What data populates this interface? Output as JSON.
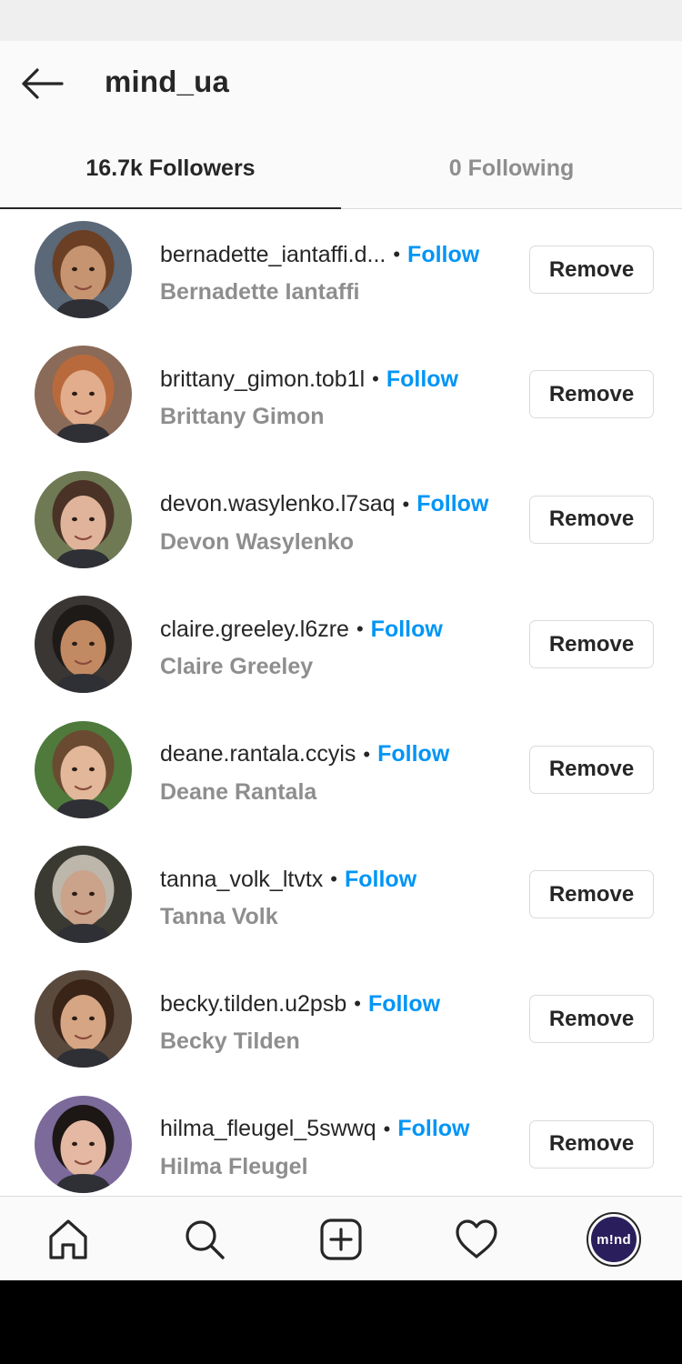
{
  "header": {
    "title": "mind_ua"
  },
  "tabs": {
    "followers": "16.7k Followers",
    "following": "0 Following"
  },
  "colors": {
    "link": "#0095f6",
    "secondary_text": "#8e8e8e",
    "primary_text": "#262626"
  },
  "followers": [
    {
      "username": "bernadette_iantaffi.d...",
      "full_name": "Bernadette Iantaffi",
      "follow_label": "Follow",
      "remove_label": "Remove",
      "skin": "#c69470",
      "hair": "#6b3f24",
      "bg": "#5a6878"
    },
    {
      "username": "brittany_gimon.tob1l",
      "full_name": "Brittany Gimon",
      "follow_label": "Follow",
      "remove_label": "Remove",
      "skin": "#e2ad8c",
      "hair": "#b86a3c",
      "bg": "#8a6a58"
    },
    {
      "username": "devon.wasylenko.l7saq",
      "full_name": "Devon Wasylenko",
      "follow_label": "Follow",
      "remove_label": "Remove",
      "skin": "#e0b49a",
      "hair": "#4a3326",
      "bg": "#6f7a55"
    },
    {
      "username": "claire.greeley.l6zre",
      "full_name": "Claire Greeley",
      "follow_label": "Follow",
      "remove_label": "Remove",
      "skin": "#c28a63",
      "hair": "#1e1a17",
      "bg": "#3a3634"
    },
    {
      "username": "deane.rantala.ccyis",
      "full_name": "Deane Rantala",
      "follow_label": "Follow",
      "remove_label": "Remove",
      "skin": "#e2b79a",
      "hair": "#6a4a30",
      "bg": "#4f7a3c"
    },
    {
      "username": "tanna_volk_ltvtx",
      "full_name": "Tanna Volk",
      "follow_label": "Follow",
      "remove_label": "Remove",
      "skin": "#caa38a",
      "hair": "#bcb6ab",
      "bg": "#3b3a32"
    },
    {
      "username": "becky.tilden.u2psb",
      "full_name": "Becky Tilden",
      "follow_label": "Follow",
      "remove_label": "Remove",
      "skin": "#d6a584",
      "hair": "#3a2418",
      "bg": "#5a4a3e"
    },
    {
      "username": "hilma_fleugel_5swwq",
      "full_name": "Hilma Fleugel",
      "follow_label": "Follow",
      "remove_label": "Remove",
      "skin": "#e4b8a2",
      "hair": "#1c1614",
      "bg": "#7b6a9a"
    }
  ],
  "bottom_nav": {
    "items": [
      "home-icon",
      "search-icon",
      "new-post-icon",
      "activity-heart-icon",
      "profile-avatar"
    ],
    "profile_text": "m!nd"
  }
}
